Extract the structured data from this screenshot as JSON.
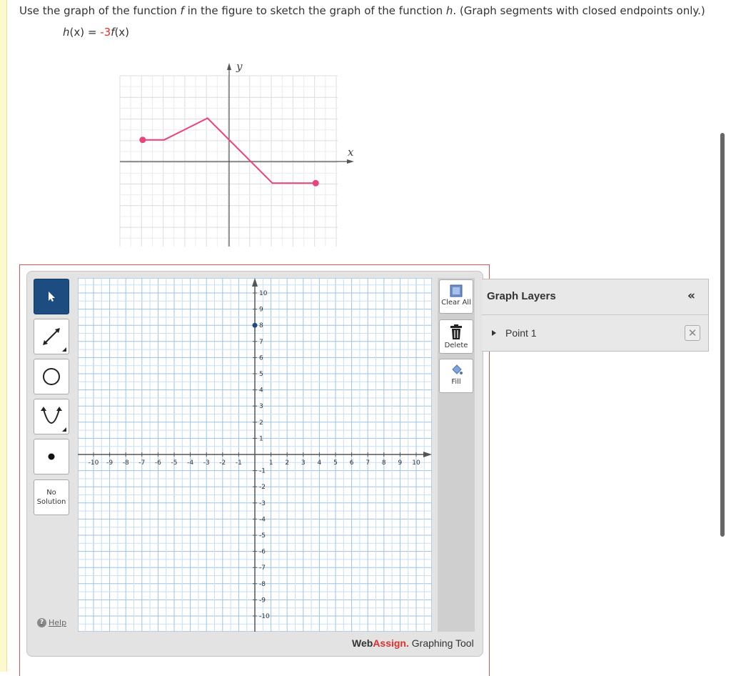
{
  "question": {
    "part1": "Use the graph of the function ",
    "f": "f",
    "part2": " in the figure to sketch the graph of the function ",
    "h": "h",
    "part3": ". (Graph segments with closed endpoints only.)"
  },
  "equation": {
    "lhs_func": "h",
    "lhs_rest": "(x) = ",
    "coef": "-3",
    "rhs_func": "f",
    "rhs_rest": "(x)"
  },
  "figure": {
    "x_label": "x",
    "y_label": "y",
    "polyline": [
      [
        -4,
        1
      ],
      [
        -3,
        1
      ],
      [
        -1,
        2
      ],
      [
        2,
        -1
      ],
      [
        4,
        -1
      ]
    ],
    "endpoints": [
      [
        -4,
        1
      ],
      [
        4,
        -1
      ]
    ],
    "color": "#e8457a"
  },
  "tools": {
    "no_solution": "No Solution",
    "help": "Help",
    "clear_all": "Clear All",
    "delete": "Delete",
    "fill": "Fill"
  },
  "grid": {
    "xmin": -10,
    "xmax": 10,
    "ymin": -10,
    "ymax": 10,
    "x_ticks": [
      "-10",
      "-9",
      "-8",
      "-7",
      "-6",
      "-5",
      "-4",
      "-3",
      "-2",
      "-1",
      "1",
      "2",
      "3",
      "4",
      "5",
      "6",
      "7",
      "8",
      "9",
      "10"
    ],
    "y_ticks": [
      "10",
      "9",
      "8",
      "7",
      "6",
      "5",
      "4",
      "3",
      "2",
      "1",
      "-1",
      "-2",
      "-3",
      "-4",
      "-5",
      "-6",
      "-7",
      "-8",
      "-9",
      "-10"
    ],
    "point": [
      0,
      8
    ],
    "point_color": "#1d4d80"
  },
  "brand": {
    "web": "Web",
    "assign": "Assign.",
    "tool": " Graphing Tool"
  },
  "layers": {
    "title": "Graph Layers",
    "collapse": "«",
    "items": [
      {
        "label": "Point 1"
      }
    ]
  }
}
